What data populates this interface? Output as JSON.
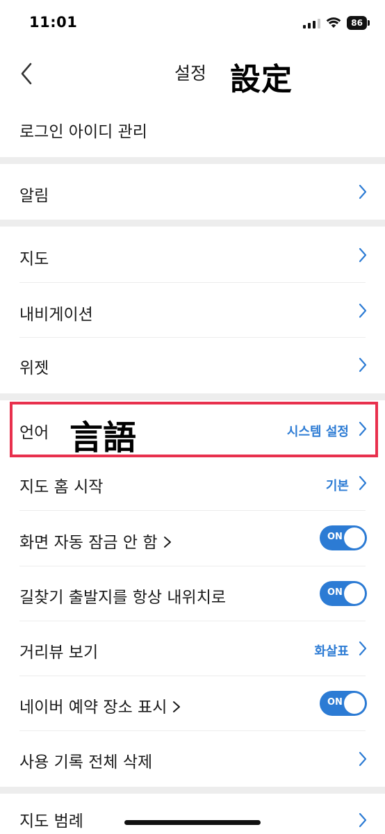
{
  "status_bar": {
    "time": "11:01",
    "battery": "86",
    "signal_icon": "signal-bars-icon",
    "wifi_icon": "wifi-icon"
  },
  "nav": {
    "title": "설정",
    "annotation": "設定",
    "back_icon": "chevron-left-icon"
  },
  "rows": {
    "login_id": {
      "label": "로그인 아이디 관리"
    },
    "alerts": {
      "label": "알림"
    },
    "map": {
      "label": "지도"
    },
    "navigation": {
      "label": "내비게이션"
    },
    "widget": {
      "label": "위젯"
    },
    "language": {
      "label": "언어",
      "value": "시스템 설정",
      "annotation": "言語"
    },
    "map_home_start": {
      "label": "지도 홈 시작",
      "value": "기본"
    },
    "screen_autolock": {
      "label": "화면 자동 잠금 안 함",
      "toggle": "ON"
    },
    "route_start": {
      "label": "길찾기 출발지를 항상 내위치로",
      "toggle": "ON"
    },
    "street_view": {
      "label": "거리뷰 보기",
      "value": "화살표"
    },
    "naver_reservation": {
      "label": "네이버 예약 장소 표시",
      "toggle": "ON"
    },
    "delete_history": {
      "label": "사용 기록 전체 삭제"
    },
    "map_legend": {
      "label": "지도 범례"
    }
  },
  "colors": {
    "accent": "#2c7bd4",
    "highlight": "#e8304d",
    "section_gap": "#ededed"
  }
}
